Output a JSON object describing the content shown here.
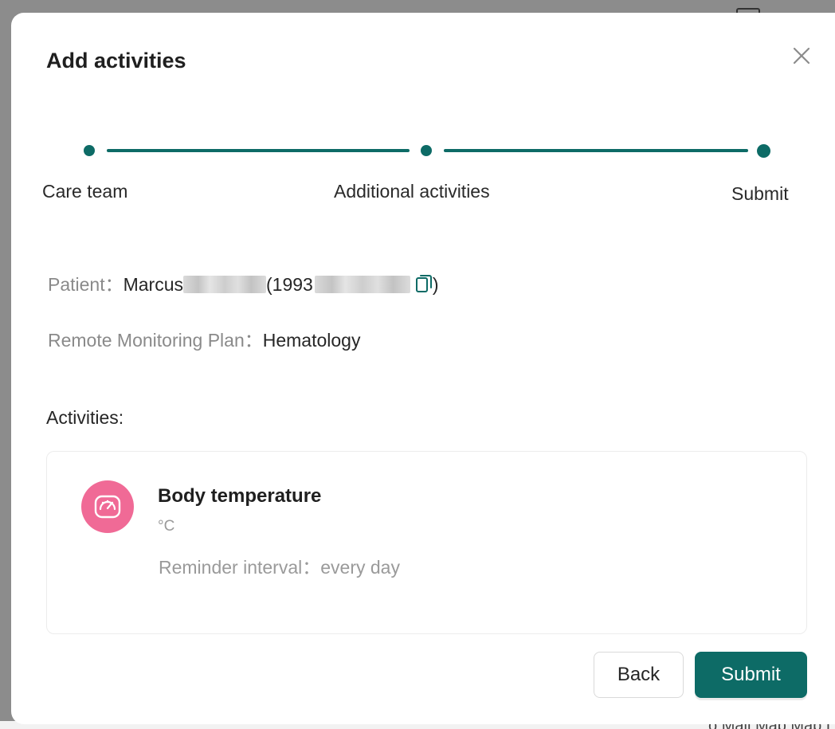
{
  "dialog": {
    "title": "Add activities"
  },
  "stepper": {
    "steps": [
      {
        "label": "Care team"
      },
      {
        "label": "Additional activities"
      },
      {
        "label": "Submit"
      }
    ],
    "accent_color": "#0d6b66"
  },
  "patient": {
    "label": "Patient：",
    "first_name": "Marcus",
    "id_prefix": "(1993",
    "id_suffix": ")"
  },
  "plan": {
    "label": "Remote Monitoring Plan：",
    "value": "Hematology"
  },
  "activities": {
    "heading": "Activities:",
    "items": [
      {
        "name": "Body temperature",
        "unit": "°C",
        "reminder_label": "Reminder interval：",
        "reminder_value": "every day",
        "icon": "gauge-icon",
        "icon_bg": "#f06a96"
      }
    ]
  },
  "footer": {
    "back_label": "Back",
    "submit_label": "Submit"
  },
  "background": {
    "partial_text": "o Mail Mab Mab L"
  }
}
